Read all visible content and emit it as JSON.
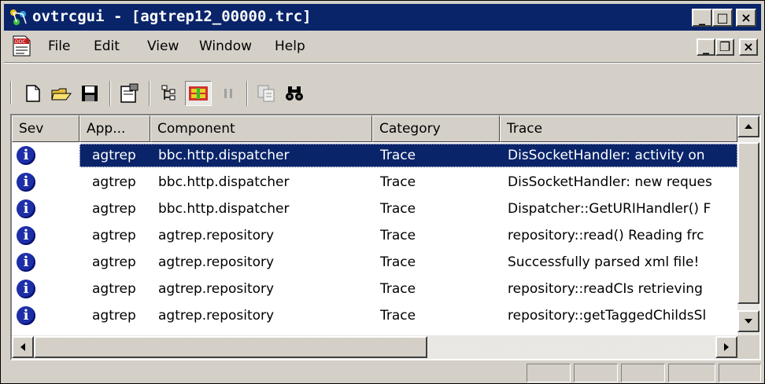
{
  "window": {
    "title": "ovtrcgui - [agtrep12_00000.trc]"
  },
  "caption_buttons": {
    "minimize": "_",
    "maximize": "□",
    "close": "×"
  },
  "mdi_buttons": {
    "minimize": "_",
    "restore": "❐",
    "close": "×"
  },
  "menu": [
    {
      "label": "File"
    },
    {
      "label": "Edit"
    },
    {
      "label": "View"
    },
    {
      "label": "Window"
    },
    {
      "label": "Help"
    }
  ],
  "toolbar": {
    "buttons": [
      {
        "icon": "new-document-icon"
      },
      {
        "icon": "open-folder-icon"
      },
      {
        "icon": "save-disk-icon"
      },
      {
        "icon": "properties-icon"
      },
      {
        "icon": "tree-icon"
      },
      {
        "icon": "follow-trace-icon",
        "pressed": true
      },
      {
        "icon": "pause-icon",
        "disabled": true
      },
      {
        "icon": "copy-icon",
        "disabled": true
      },
      {
        "icon": "find-binoculars-icon"
      }
    ]
  },
  "list": {
    "columns": [
      "Sev",
      "App...",
      "Component",
      "Category",
      "Trace"
    ],
    "rows": [
      {
        "sev": "i",
        "app": "agtrep",
        "component": "bbc.http.dispatcher",
        "category": "Trace",
        "trace": "DisSocketHandler: activity on",
        "selected": true
      },
      {
        "sev": "i",
        "app": "agtrep",
        "component": "bbc.http.dispatcher",
        "category": "Trace",
        "trace": "DisSocketHandler: new reques"
      },
      {
        "sev": "i",
        "app": "agtrep",
        "component": "bbc.http.dispatcher",
        "category": "Trace",
        "trace": "Dispatcher::GetURIHandler() F"
      },
      {
        "sev": "i",
        "app": "agtrep",
        "component": "agtrep.repository",
        "category": "Trace",
        "trace": "repository::read() Reading frc"
      },
      {
        "sev": "i",
        "app": "agtrep",
        "component": "agtrep.repository",
        "category": "Trace",
        "trace": "Successfully parsed xml file!"
      },
      {
        "sev": "i",
        "app": "agtrep",
        "component": "agtrep.repository",
        "category": "Trace",
        "trace": "repository::readCIs retrieving"
      },
      {
        "sev": "i",
        "app": "agtrep",
        "component": "agtrep.repository",
        "category": "Trace",
        "trace": "repository::getTaggedChildsSl"
      }
    ]
  },
  "colors": {
    "titlebar": "#0a246a",
    "selection": "#0a246a",
    "face": "#d4d0c8",
    "info_icon": "#1d2ea8"
  }
}
